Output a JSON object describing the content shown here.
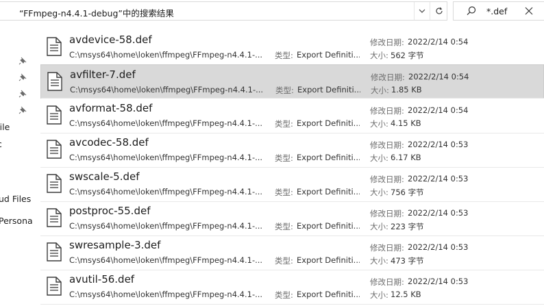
{
  "address_bar": {
    "path_text": "“FFmpeg-n4.4.1-debug”中的搜索结果"
  },
  "search_box": {
    "query": "*.def"
  },
  "nav_fragments": [
    {
      "label": "oile"
    },
    {
      "label": "c"
    },
    {
      "label": "ud Files"
    },
    {
      "label": "Persona"
    }
  ],
  "labels": {
    "type_label": "类型:",
    "modified_label": "修改日期:",
    "size_label": "大小:"
  },
  "results": [
    {
      "name": "avdevice-58.def",
      "path": "C:\\msys64\\home\\loken\\ffmpeg\\FFmpeg-n4.4.1-...",
      "type": "Export Definiti...",
      "modified": "2022/2/14 0:54",
      "size": "562 字节"
    },
    {
      "name": "avfilter-7.def",
      "path": "C:\\msys64\\home\\loken\\ffmpeg\\FFmpeg-n4.4.1-...",
      "type": "Export Definiti...",
      "modified": "2022/2/14 0:54",
      "size": "1.85 KB"
    },
    {
      "name": "avformat-58.def",
      "path": "C:\\msys64\\home\\loken\\ffmpeg\\FFmpeg-n4.4.1-...",
      "type": "Export Definiti...",
      "modified": "2022/2/14 0:54",
      "size": "4.15 KB"
    },
    {
      "name": "avcodec-58.def",
      "path": "C:\\msys64\\home\\loken\\ffmpeg\\FFmpeg-n4.4.1-...",
      "type": "Export Definiti...",
      "modified": "2022/2/14 0:53",
      "size": "6.17 KB"
    },
    {
      "name": "swscale-5.def",
      "path": "C:\\msys64\\home\\loken\\ffmpeg\\FFmpeg-n4.4.1-...",
      "type": "Export Definiti...",
      "modified": "2022/2/14 0:53",
      "size": "756 字节"
    },
    {
      "name": "postproc-55.def",
      "path": "C:\\msys64\\home\\loken\\ffmpeg\\FFmpeg-n4.4.1-...",
      "type": "Export Definiti...",
      "modified": "2022/2/14 0:53",
      "size": "223 字节"
    },
    {
      "name": "swresample-3.def",
      "path": "C:\\msys64\\home\\loken\\ffmpeg\\FFmpeg-n4.4.1-...",
      "type": "Export Definiti...",
      "modified": "2022/2/14 0:53",
      "size": "473 字节"
    },
    {
      "name": "avutil-56.def",
      "path": "C:\\msys64\\home\\loken\\ffmpeg\\FFmpeg-n4.4.1-...",
      "type": "Export Definiti...",
      "modified": "2022/2/14 0:53",
      "size": "12.5 KB"
    }
  ],
  "selected_index": 1,
  "icons": {
    "address_dropdown": "chevron-down-icon",
    "refresh": "refresh-icon",
    "search": "search-icon",
    "clear": "close-icon",
    "pin": "pin-icon",
    "file": "document-icon"
  },
  "colors": {
    "selected_row": "#d9d9d9",
    "border": "#d9d9d9"
  }
}
